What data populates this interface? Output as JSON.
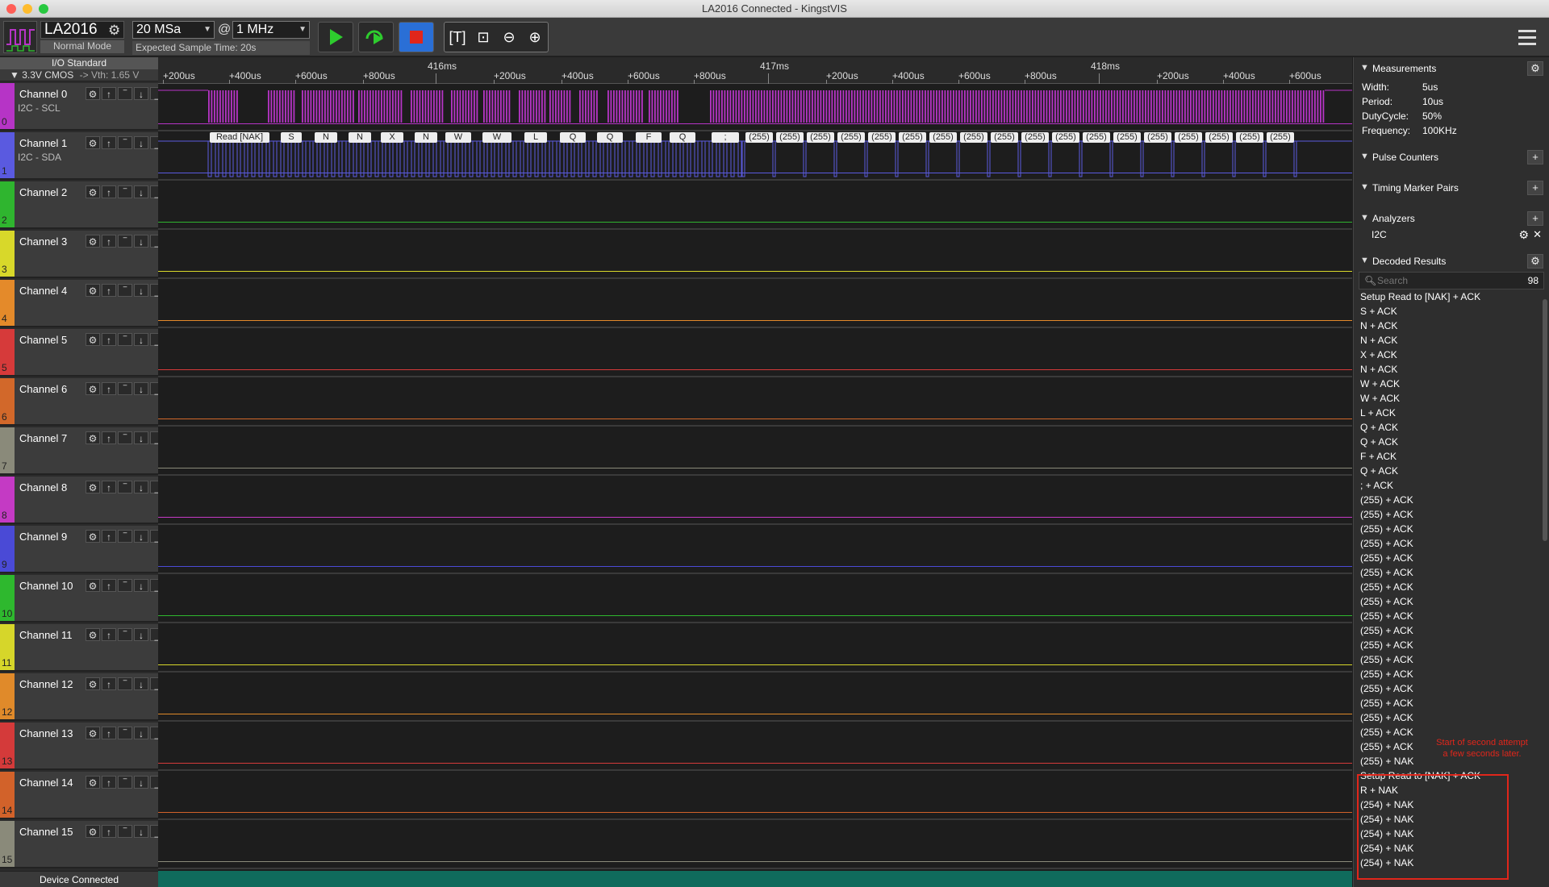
{
  "window": {
    "title": "LA2016 Connected - KingstVIS"
  },
  "toolbar": {
    "device_name": "LA2016",
    "device_mode": "Normal Mode",
    "sample_depth": "20 MSa",
    "at_symbol": "@",
    "sample_rate": "1 MHz",
    "expected_time": "Expected Sample Time: 20s",
    "icons": [
      "run-icon",
      "repeat-run-icon",
      "stop-icon",
      "text-icon",
      "zoom-fit-icon",
      "zoom-out-icon",
      "zoom-in-icon",
      "menu-icon"
    ]
  },
  "io": {
    "title": "I/O Standard",
    "value": "3.3V CMOS",
    "vth": "-> Vth: 1.65 V"
  },
  "channels": [
    {
      "name": "Channel 0",
      "sub": "I2C - SCL",
      "num": "0",
      "color": "#b634c6"
    },
    {
      "name": "Channel 1",
      "sub": "I2C - SDA",
      "num": "1",
      "color": "#5a5ae0"
    },
    {
      "name": "Channel 2",
      "sub": "",
      "num": "2",
      "color": "#2fb52f"
    },
    {
      "name": "Channel 3",
      "sub": "",
      "num": "3",
      "color": "#d8d82a"
    },
    {
      "name": "Channel 4",
      "sub": "",
      "num": "4",
      "color": "#e48a2a"
    },
    {
      "name": "Channel 5",
      "sub": "",
      "num": "5",
      "color": "#d63a3a"
    },
    {
      "name": "Channel 6",
      "sub": "",
      "num": "6",
      "color": "#d2682a"
    },
    {
      "name": "Channel 7",
      "sub": "",
      "num": "7",
      "color": "#8a8a7a"
    },
    {
      "name": "Channel 8",
      "sub": "",
      "num": "8",
      "color": "#c43ac4"
    },
    {
      "name": "Channel 9",
      "sub": "",
      "num": "9",
      "color": "#4a4ad6"
    },
    {
      "name": "Channel 10",
      "sub": "",
      "num": "10",
      "color": "#2eb82e"
    },
    {
      "name": "Channel 11",
      "sub": "",
      "num": "11",
      "color": "#d6d62a"
    },
    {
      "name": "Channel 12",
      "sub": "",
      "num": "12",
      "color": "#e08a2a"
    },
    {
      "name": "Channel 13",
      "sub": "",
      "num": "13",
      "color": "#d43a3a"
    },
    {
      "name": "Channel 14",
      "sub": "",
      "num": "14",
      "color": "#d2622a"
    },
    {
      "name": "Channel 15",
      "sub": "",
      "num": "15",
      "color": "#8a8a7a"
    }
  ],
  "status": {
    "device": "Device Connected"
  },
  "ruler": {
    "labels": [
      "+200us",
      "+400us",
      "+600us",
      "+800us",
      "416ms",
      "+200us",
      "+400us",
      "+600us",
      "+800us",
      "417ms",
      "+200us",
      "+400us",
      "+600us",
      "+800us",
      "418ms",
      "+200us",
      "+400us",
      "+600us"
    ]
  },
  "decoded_labels": [
    "Read [NAK]",
    "S",
    "N",
    "N",
    "X",
    "N",
    "W",
    "W",
    "L",
    "Q",
    "Q",
    "F",
    "Q",
    ";",
    "(255)",
    "(255)",
    "(255)",
    "(255)",
    "(255)",
    "(255)",
    "(255)",
    "(255)",
    "(255)",
    "(255)",
    "(255)",
    "(255)",
    "(255)",
    "(255)",
    "(255)",
    "(255)",
    "(255)",
    "(255)"
  ],
  "measurements": {
    "title": "Measurements",
    "rows": [
      {
        "label": "Width:",
        "value": "5us"
      },
      {
        "label": "Period:",
        "value": "10us"
      },
      {
        "label": "DutyCycle:",
        "value": "50%"
      },
      {
        "label": "Frequency:",
        "value": "100KHz"
      }
    ]
  },
  "sections": {
    "pulse_counters": "Pulse Counters",
    "timing_marker_pairs": "Timing Marker Pairs",
    "analyzers": "Analyzers",
    "decoded_results": "Decoded Results"
  },
  "analyzers": [
    {
      "name": "I2C"
    }
  ],
  "search": {
    "placeholder": "Search",
    "count": "98"
  },
  "results": [
    "Setup Read to [NAK] + ACK",
    "S + ACK",
    "N + ACK",
    "N + ACK",
    "X + ACK",
    "N + ACK",
    "W + ACK",
    "W + ACK",
    "L + ACK",
    "Q + ACK",
    "Q + ACK",
    "F + ACK",
    "Q + ACK",
    "; + ACK",
    "(255) + ACK",
    "(255) + ACK",
    "(255) + ACK",
    "(255) + ACK",
    "(255) + ACK",
    "(255) + ACK",
    "(255) + ACK",
    "(255) + ACK",
    "(255) + ACK",
    "(255) + ACK",
    "(255) + ACK",
    "(255) + ACK",
    "(255) + ACK",
    "(255) + ACK",
    "(255) + ACK",
    "(255) + ACK",
    "(255) + ACK",
    "(255) + ACK",
    "(255) + NAK",
    "Setup Read to [NAK] + ACK",
    "R + NAK",
    "(254) + NAK",
    "(254) + NAK",
    "(254) + NAK",
    "(254) + NAK",
    "(254) + NAK"
  ],
  "annotation": "Start of second attempt a few seconds later."
}
